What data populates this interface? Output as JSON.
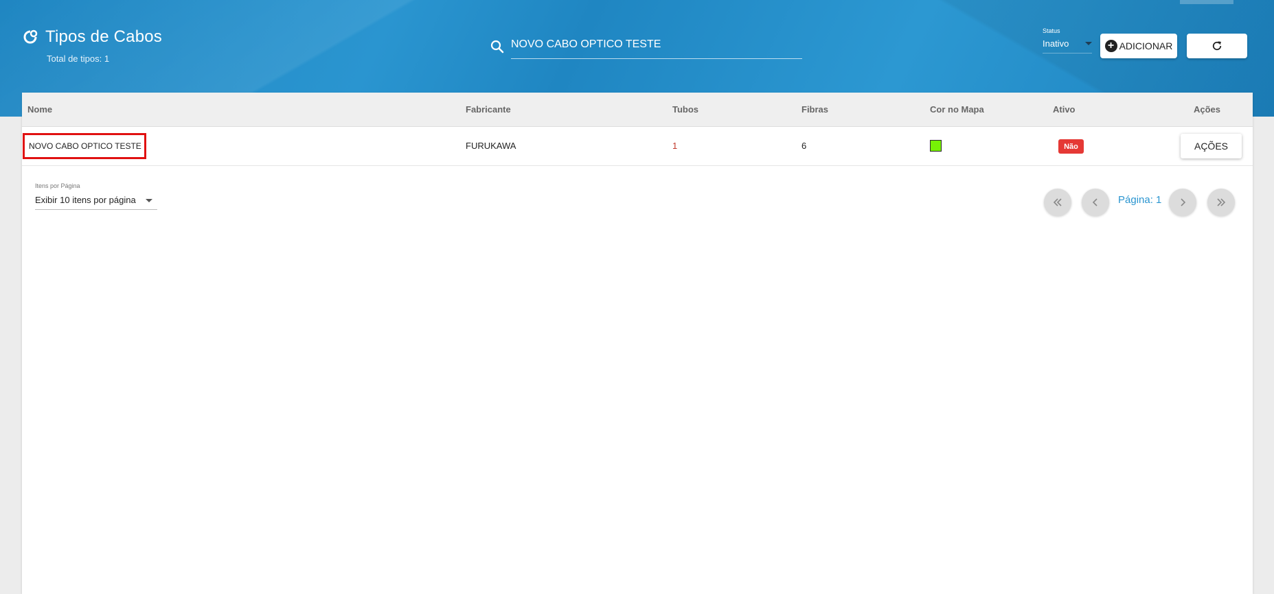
{
  "header": {
    "title": "Tipos de Cabos",
    "subtitle": "Total de tipos: 1",
    "search_value": "NOVO CABO OPTICO TESTE",
    "status_label": "Status",
    "status_value": "Inativo",
    "add_label": "ADICIONAR"
  },
  "table": {
    "columns": [
      "Nome",
      "Fabricante",
      "Tubos",
      "Fibras",
      "Cor no Mapa",
      "Ativo",
      "Ações"
    ],
    "rows": [
      {
        "nome": "NOVO CABO OPTICO TESTE",
        "fabricante": "FURUKAWA",
        "tubos": "1",
        "fibras": "6",
        "cor": "#77f106",
        "ativo": "Não",
        "acoes": "AÇÕES"
      }
    ]
  },
  "pagination": {
    "per_page_label": "Itens por Página",
    "per_page_value": "Exibir 10 itens por página",
    "page_label": "Página: 1"
  },
  "colors": {
    "header_blue": "#2a95d0",
    "badge_red": "#e53935",
    "highlight_red": "#e01010"
  }
}
